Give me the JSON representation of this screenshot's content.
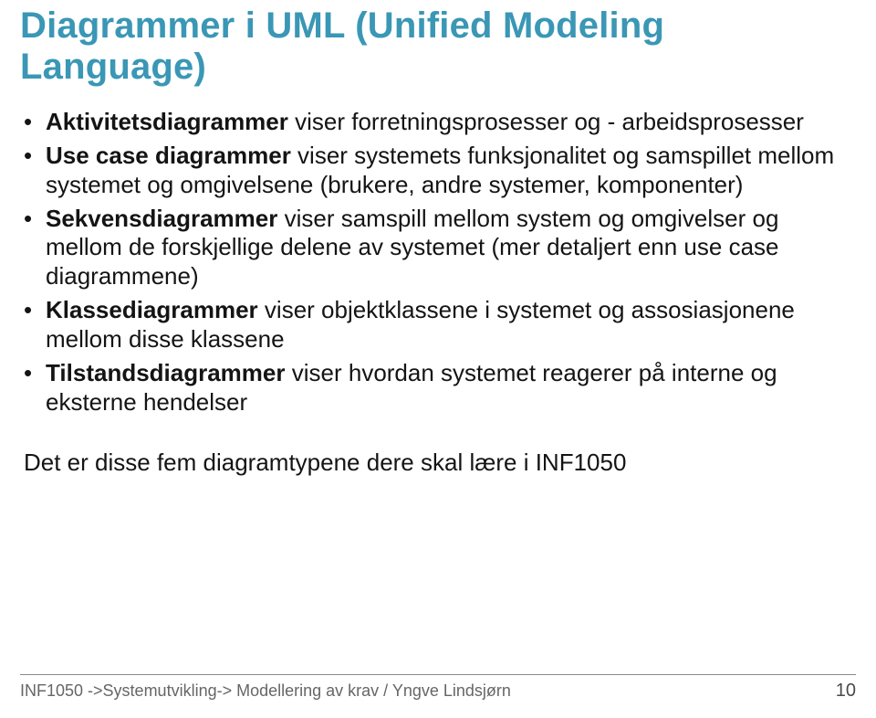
{
  "title": "Diagrammer i UML (Unified Modeling Language)",
  "bullets": [
    {
      "term": "Aktivitetsdiagrammer",
      "rest": " viser forretningsprosesser og - arbeidsprosesser"
    },
    {
      "term": "Use case diagrammer",
      "rest": " viser systemets funksjonalitet og samspillet mellom systemet og omgivelsene (brukere, andre systemer, komponenter)"
    },
    {
      "term": "Sekvensdiagrammer",
      "rest": " viser samspill mellom system og omgivelser og mellom de forskjellige delene av systemet (mer detaljert enn use case diagrammene)"
    },
    {
      "term": "Klassediagrammer",
      "rest": " viser objektklassene i systemet og assosiasjonene mellom disse klassene"
    },
    {
      "term": "Tilstandsdiagrammer",
      "rest": " viser hvordan systemet reagerer på interne og eksterne hendelser"
    }
  ],
  "closing": "Det er disse fem diagramtypene dere skal lære i INF1050",
  "footer": {
    "left": "INF1050 ->Systemutvikling-> Modellering av krav / Yngve Lindsjørn",
    "page": "10"
  }
}
